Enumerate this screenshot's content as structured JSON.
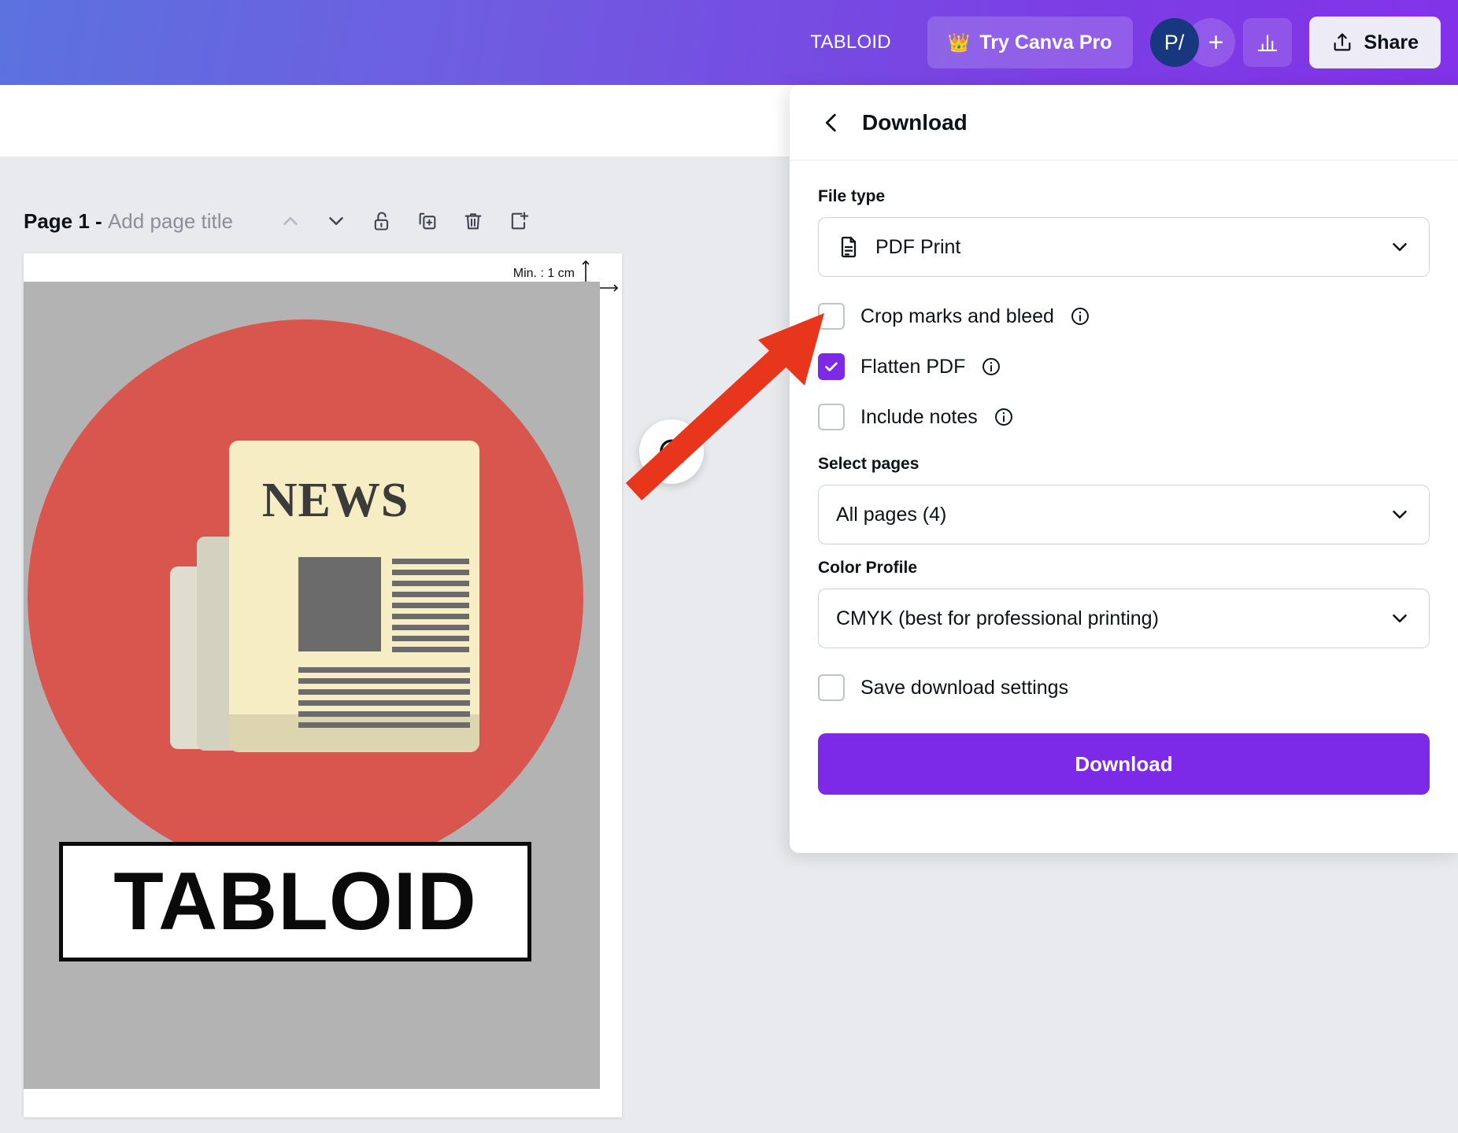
{
  "topbar": {
    "doc_title": "TABLOID",
    "pro_button": "Try Canva Pro",
    "crown_icon": "crown-icon",
    "avatar_initials": "P/",
    "add_collaborator": "+",
    "stats_icon": "bar-chart-icon",
    "share_label": "Share",
    "share_icon": "upload-icon",
    "accent_purple": "#7b3fe4"
  },
  "canvas": {
    "page_label_bold": "Page 1 -",
    "page_label_muted": "Add page title",
    "tools": [
      {
        "name": "move-page-up-icon",
        "glyph": "chevron-up",
        "disabled": true
      },
      {
        "name": "move-page-down-icon",
        "glyph": "chevron-down",
        "disabled": false
      },
      {
        "name": "lock-page-icon",
        "glyph": "unlock",
        "disabled": false
      },
      {
        "name": "duplicate-page-icon",
        "glyph": "duplicate",
        "disabled": false
      },
      {
        "name": "delete-page-icon",
        "glyph": "trash",
        "disabled": false
      },
      {
        "name": "add-page-icon",
        "glyph": "add-page",
        "disabled": false
      }
    ],
    "margin_hint": "Min. : 1 cm",
    "comment_icon": "add-comment-icon",
    "design": {
      "headline": "NEWS",
      "footer_text": "TABLOID",
      "circle_color": "#d9564f",
      "background_color": "#b3b3b3",
      "paper_color": "#f6edc4"
    }
  },
  "panel": {
    "back_icon": "back-chevron-icon",
    "title": "Download",
    "file_type": {
      "label": "File type",
      "value": "PDF Print",
      "icon": "pdf-file-icon",
      "chevron": "chevron-down-icon"
    },
    "options": [
      {
        "label": "Crop marks and bleed",
        "checked": false,
        "info": true,
        "name": "crop-marks-and-bleed"
      },
      {
        "label": "Flatten PDF",
        "checked": true,
        "info": true,
        "name": "flatten-pdf"
      },
      {
        "label": "Include notes",
        "checked": false,
        "info": true,
        "name": "include-notes"
      }
    ],
    "select_pages": {
      "label": "Select pages",
      "value": "All pages (4)",
      "chevron": "chevron-down-icon"
    },
    "color_profile": {
      "label": "Color Profile",
      "value": "CMYK (best for professional printing)",
      "chevron": "chevron-down-icon"
    },
    "save_settings": {
      "label": "Save download settings",
      "checked": false
    },
    "download_button": "Download",
    "button_color": "#7d2ae8"
  },
  "annotation": {
    "arrow_color": "#e8361c",
    "target": "crop-marks-and-bleed-checkbox"
  }
}
